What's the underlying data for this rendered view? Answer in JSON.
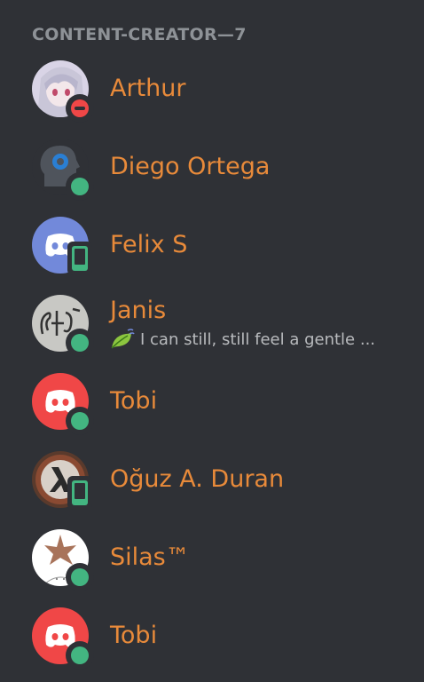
{
  "members_header": "CONTENT-CREATOR—7",
  "members": [
    {
      "name": "Arthur",
      "status": "dnd",
      "avatar": "anime-avatar"
    },
    {
      "name": "Diego Ortega",
      "status": "online",
      "avatar": "gear-head-avatar"
    },
    {
      "name": "Felix S",
      "status": "mobile",
      "avatar": "discord-logo-avatar"
    },
    {
      "name": "Janis",
      "status": "online",
      "avatar": "sketch-avatar",
      "activity": "I can still, still feel a gentle ..."
    },
    {
      "name": "Tobi",
      "status": "online",
      "avatar": "discord-logo-avatar"
    },
    {
      "name": "Oğuz A. Duran",
      "status": "mobile",
      "avatar": "half-life-avatar"
    },
    {
      "name": "Silas™",
      "status": "online",
      "avatar": "starfish-avatar"
    },
    {
      "name": "Tobi",
      "status": "online",
      "avatar": "discord-logo-avatar"
    }
  ],
  "colors": {
    "background": "#2f3136",
    "name": "#e88a3a",
    "header": "#8e9297",
    "online": "#43b581",
    "dnd": "#f04747",
    "blurple": "#7289da",
    "red": "#f04747"
  }
}
